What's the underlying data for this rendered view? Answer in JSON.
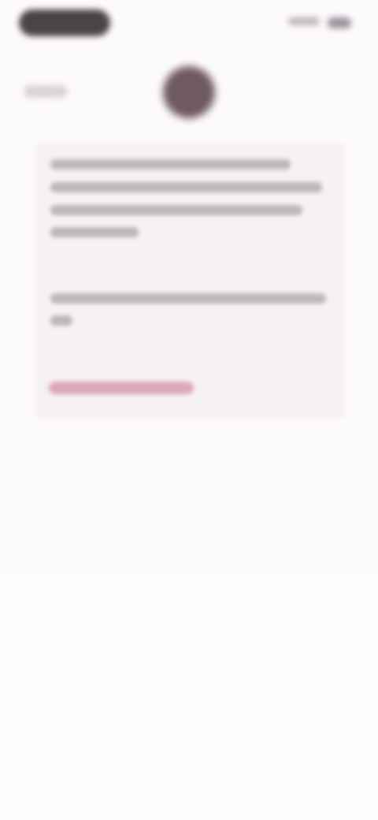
{
  "status_bar": {
    "pill_label": "",
    "icons": [
      "signal-icon",
      "battery-icon"
    ]
  },
  "header": {
    "back_label": "",
    "avatar_label": ""
  },
  "card": {
    "paragraph_1": "",
    "paragraph_2": "",
    "action_label": ""
  },
  "colors": {
    "background": "#fdfafd",
    "card": "#f6f1f5",
    "accent": "#b94f74",
    "avatar": "#6f5a62"
  }
}
